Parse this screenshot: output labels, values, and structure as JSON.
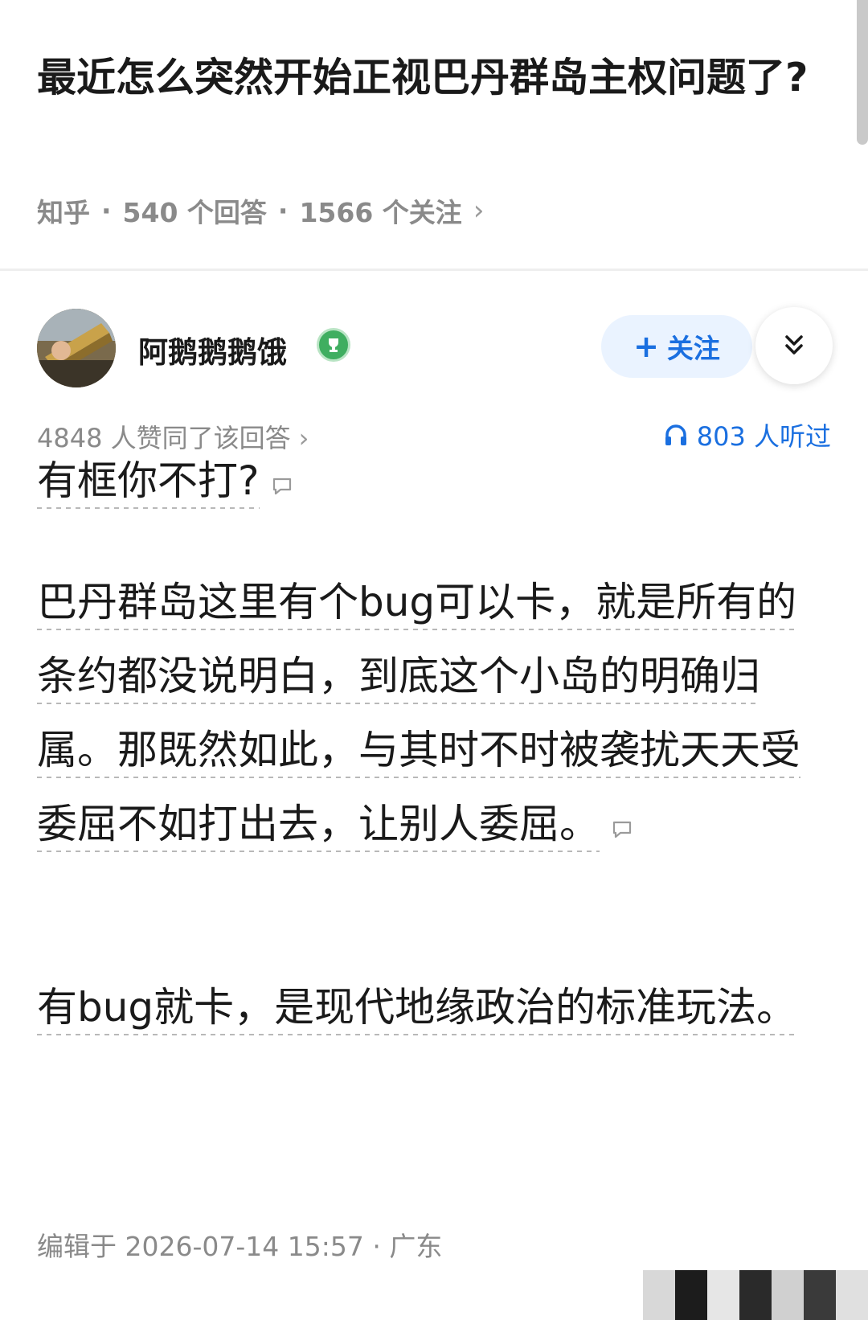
{
  "question": {
    "title": "最近怎么突然开始正视巴丹群岛主权问题了?",
    "source": "知乎",
    "answers": "540 个回答",
    "followers": "1566 个关注"
  },
  "answer": {
    "author": "阿鹅鹅鹅饿",
    "follow_label": "关注",
    "approve_text": "4848 人赞同了该回答",
    "listen_text": "803 人听过",
    "paragraphs": [
      "有框你不打?",
      "巴丹群岛这里有个bug可以卡，就是所有的条约都没说明白，到底这个小岛的明确归属。那既然如此，与其时不时被袭扰天天受委屈不如打出去，让别人委屈。",
      "有bug就卡，是现代地缘政治的标准玩法。"
    ],
    "edit_info": "编辑于 2026-07-14 15:57 · 广东"
  },
  "colors": {
    "accent": "#1a6fe0",
    "meta": "#8a8a8a",
    "badge": "#3fae60"
  }
}
